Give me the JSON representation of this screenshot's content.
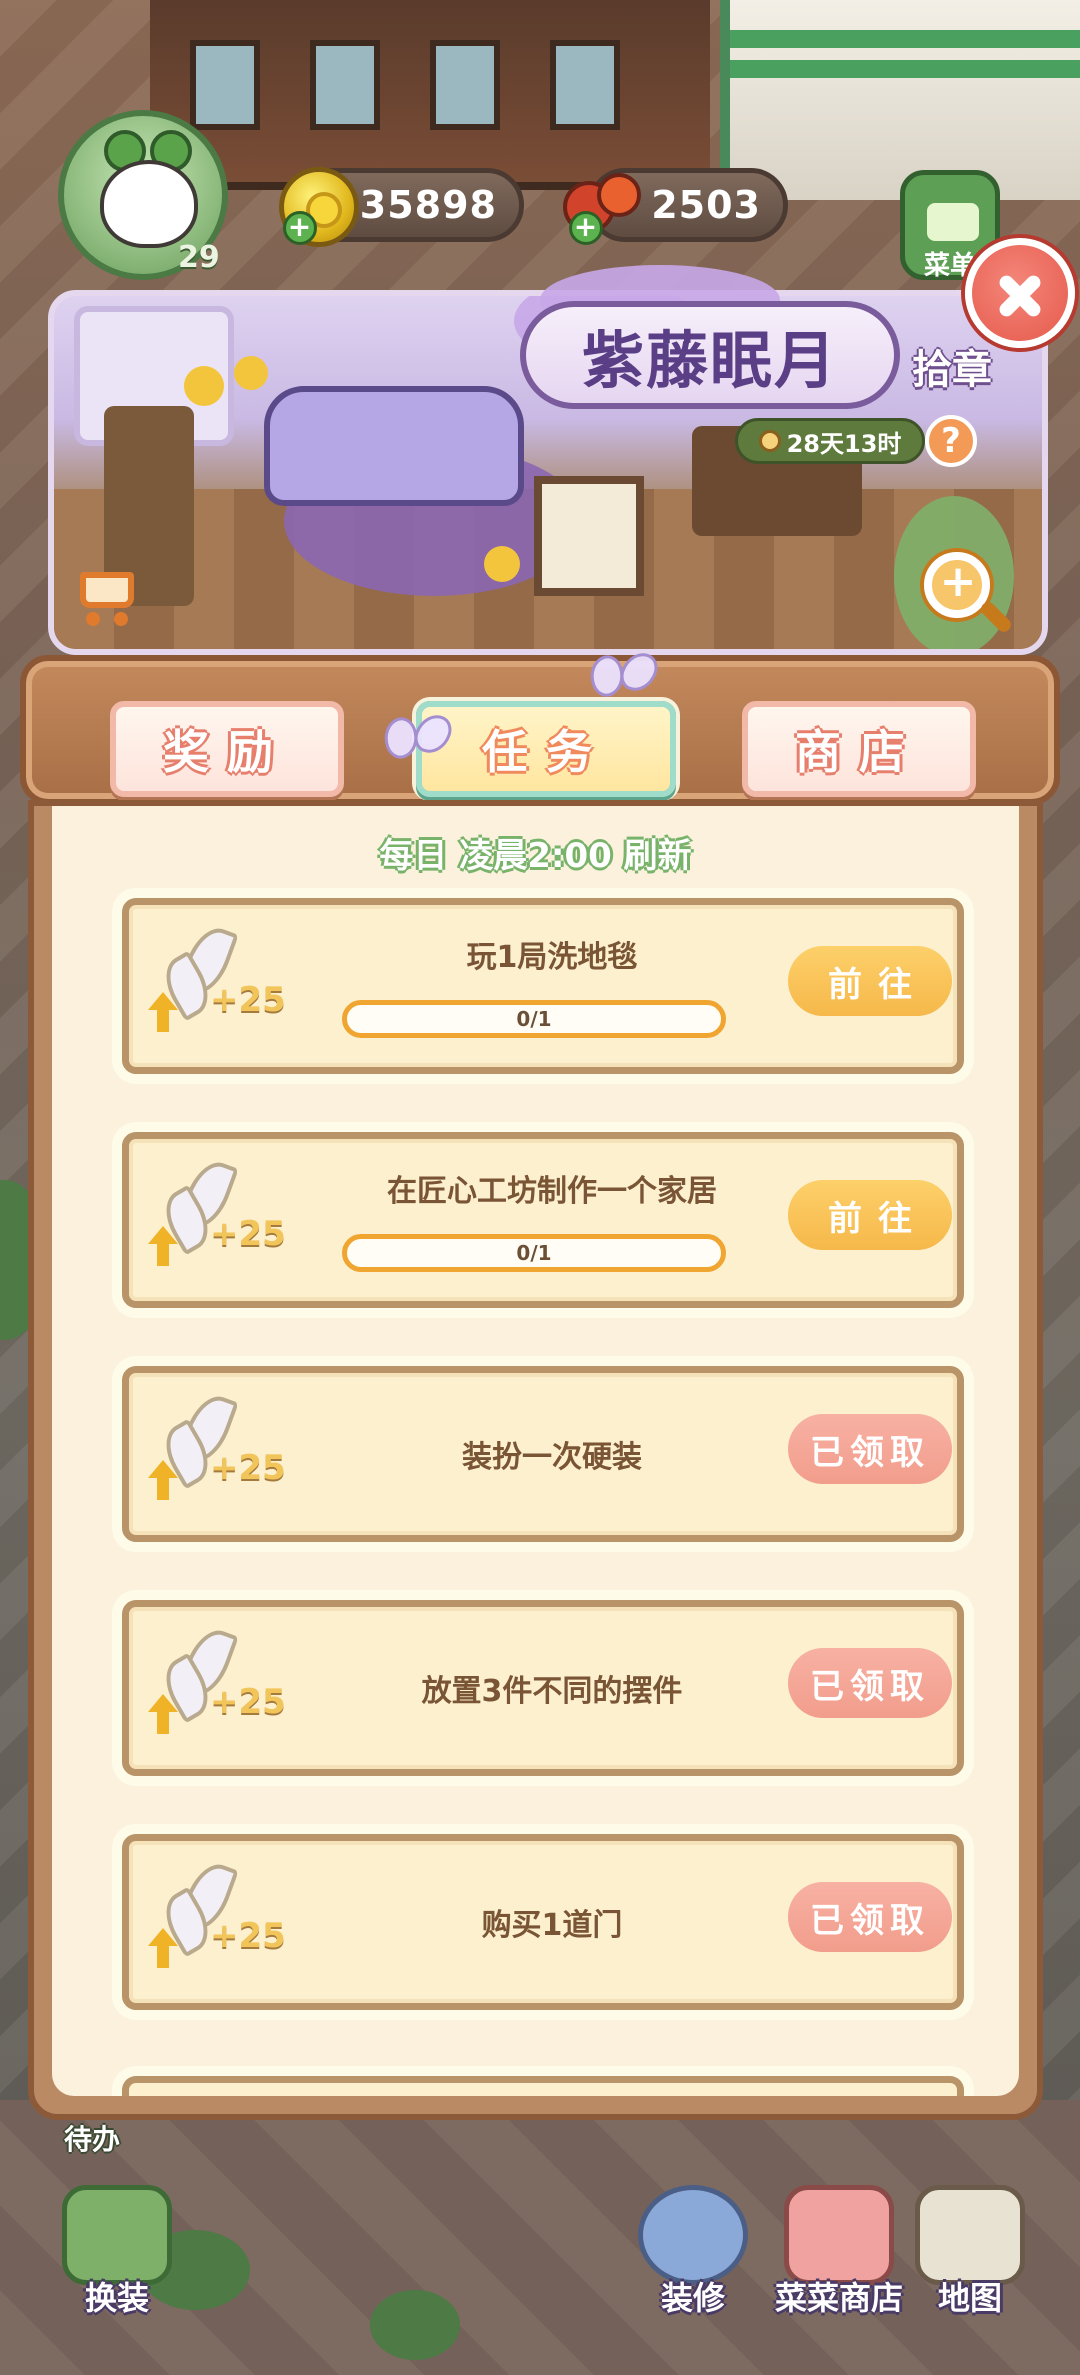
{
  "hud": {
    "level": "29",
    "coins": "35898",
    "veggies": "2503",
    "menu_label": "菜单"
  },
  "event": {
    "title": "紫藤眠月",
    "subtitle": "拾章",
    "timer": "28天13时",
    "help": "?"
  },
  "tabs": [
    {
      "label": "奖励",
      "active": false
    },
    {
      "label": "任务",
      "active": true
    },
    {
      "label": "商店",
      "active": false
    }
  ],
  "tasks_panel": {
    "refresh_note": "每日 凌晨2:00 刷新",
    "tasks": [
      {
        "title": "玩1局洗地毯",
        "reward": "+25",
        "progress": "0/1",
        "action": "前往",
        "state": "go"
      },
      {
        "title": "在匠心工坊制作一个家居",
        "reward": "+25",
        "progress": "0/1",
        "action": "前往",
        "state": "go"
      },
      {
        "title": "装扮一次硬装",
        "reward": "+25",
        "progress": null,
        "action": "已领取",
        "state": "done"
      },
      {
        "title": "放置3件不同的摆件",
        "reward": "+25",
        "progress": null,
        "action": "已领取",
        "state": "done"
      },
      {
        "title": "购买1道门",
        "reward": "+25",
        "progress": null,
        "action": "已领取",
        "state": "done"
      }
    ]
  },
  "bottom_nav": {
    "todo": "待办",
    "items": [
      {
        "label": "换装",
        "icon": "dressup-icon"
      },
      {
        "label": "装修",
        "icon": "decorate-icon"
      },
      {
        "label": "菜菜商店",
        "icon": "shop-icon"
      },
      {
        "label": "地图",
        "icon": "map-icon"
      }
    ]
  },
  "colors": {
    "go_button": "#f6b84a",
    "claimed_button": "#f29d8c",
    "panel_bg": "#fbf1dd",
    "title_purple": "#5a3e86"
  }
}
